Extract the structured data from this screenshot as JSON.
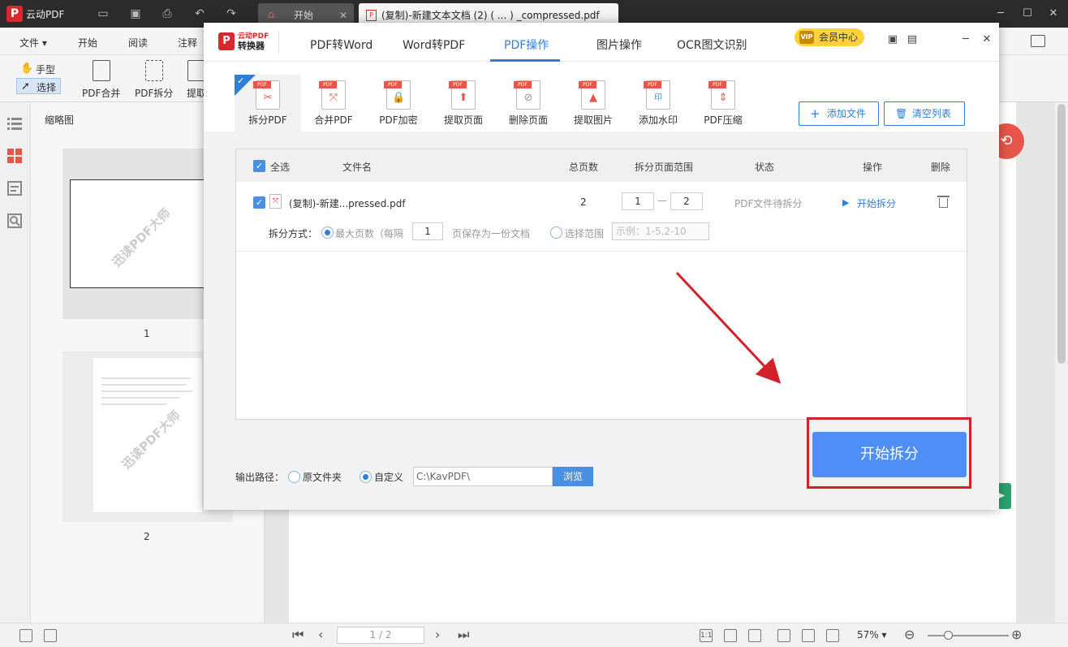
{
  "titlebar": {
    "app_name": "云动PDF",
    "tabs": [
      {
        "label": "开始"
      },
      {
        "label": "(复制)-新建文本文档 (2) ( ... ) _compressed.pdf"
      }
    ]
  },
  "menubar": {
    "items": [
      "文件",
      "开始",
      "阅读",
      "注释"
    ]
  },
  "toolbar": {
    "hand_label": "手型",
    "select_label": "选择",
    "merge_label": "PDF合并",
    "split_label": "PDF拆分",
    "extract_label": "提取"
  },
  "thumbnails": {
    "title": "缩略图",
    "pages": [
      {
        "number": "1"
      },
      {
        "number": "2"
      }
    ],
    "watermark": "迅读PDF大师"
  },
  "dialog": {
    "logo_line1": "云动PDF",
    "logo_line2": "转换器",
    "tabs": [
      "PDF转Word",
      "Word转PDF",
      "PDF操作",
      "图片操作",
      "OCR图文识别"
    ],
    "active_tab": "PDF操作",
    "vip_label": "会员中心",
    "vip_badge": "VIP",
    "subtools": [
      {
        "label": "拆分PDF",
        "glyph": "✂"
      },
      {
        "label": "合并PDF",
        "glyph": "⤧"
      },
      {
        "label": "PDF加密",
        "glyph": "🔒"
      },
      {
        "label": "提取页面",
        "glyph": "⬆"
      },
      {
        "label": "删除页面",
        "glyph": "⊘"
      },
      {
        "label": "提取图片",
        "glyph": "▲"
      },
      {
        "label": "添加水印",
        "glyph": "印"
      },
      {
        "label": "PDF压缩",
        "glyph": "⇕"
      }
    ],
    "pdf_tag": "PDF",
    "add_file_label": "添加文件",
    "clear_list_label": "清空列表",
    "list": {
      "headers": {
        "select_all": "全选",
        "filename": "文件名",
        "total_pages": "总页数",
        "range": "拆分页面范围",
        "status": "状态",
        "action": "操作",
        "delete": "删除"
      },
      "rows": [
        {
          "filename": "(复制)-新建...pressed.pdf",
          "total_pages": "2",
          "range_from": "1",
          "range_to": "2",
          "status": "PDF文件待拆分",
          "action": "开始拆分"
        }
      ],
      "split_mode_label": "拆分方式：",
      "max_pages_label": "最大页数（每隔",
      "max_pages_value": "1",
      "max_pages_suffix": "页保存为一份文档",
      "select_range_label": "选择范围",
      "range_placeholder": "示例：1-5,2-10"
    },
    "output": {
      "label": "输出路径：",
      "opt_original": "原文件夹",
      "opt_custom": "自定义",
      "path_value": "C:\\KavPDF\\",
      "browse_label": "浏览"
    },
    "start_button_label": "开始拆分"
  },
  "statusbar": {
    "page_indicator": "1 / 2",
    "zoom": "57%"
  },
  "colors": {
    "accent": "#2f7fd8",
    "brand_red": "#d9272e",
    "start_button": "#4f8ef7",
    "highlight_red": "#d3202b"
  }
}
